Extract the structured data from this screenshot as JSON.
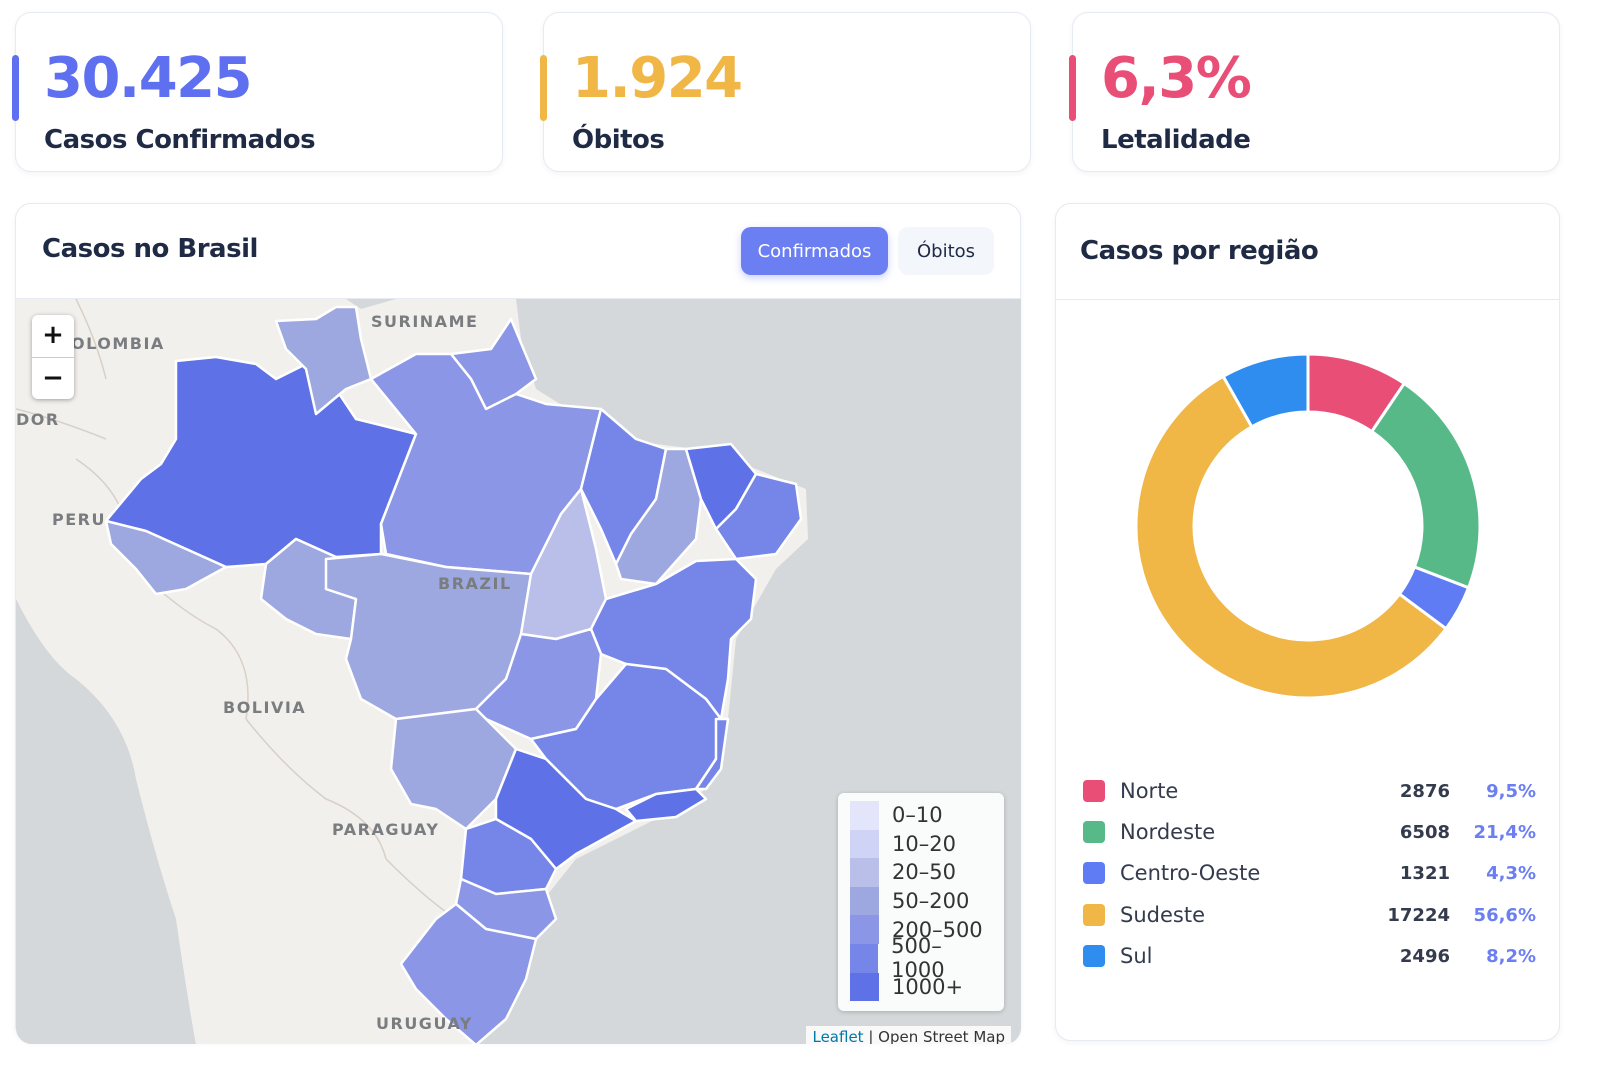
{
  "stats": [
    {
      "value": "30.425",
      "label": "Casos Confirmados",
      "color": "#5e6ff0"
    },
    {
      "value": "1.924",
      "label": "Óbitos",
      "color": "#f0b646"
    },
    {
      "value": "6,3%",
      "label": "Letalidade",
      "color": "#e94e77"
    }
  ],
  "map_card": {
    "title": "Casos no Brasil",
    "toggle": {
      "confirmed_label": "Confirmados",
      "deaths_label": "Óbitos",
      "active": "Confirmados"
    },
    "zoom": {
      "in_label": "+",
      "out_label": "−"
    },
    "country_labels": [
      "SURINAME",
      "OLOMBIA",
      "DOR",
      "PERU",
      "BRAZIL",
      "BOLIVIA",
      "PARAGUAY",
      "URUGUAY"
    ],
    "legend": [
      {
        "label": "0–10",
        "color": "#e3e6fa"
      },
      {
        "label": "10–20",
        "color": "#cfd3f5"
      },
      {
        "label": "20–50",
        "color": "#b9bfe9"
      },
      {
        "label": "50–200",
        "color": "#9ea8e0"
      },
      {
        "label": "200–500",
        "color": "#8b96e6"
      },
      {
        "label": "500–1000",
        "color": "#7585e8"
      },
      {
        "label": "1000+",
        "color": "#5f71e6"
      }
    ],
    "attribution": {
      "link": "Leaflet",
      "rest": " | Open Street Map"
    }
  },
  "region_card": {
    "title": "Casos por região",
    "regions": [
      {
        "name": "Norte",
        "count": "2876",
        "pct": "9,5%",
        "value": 2876,
        "color": "#e94e77"
      },
      {
        "name": "Nordeste",
        "count": "6508",
        "pct": "21,4%",
        "value": 6508,
        "color": "#57b988"
      },
      {
        "name": "Centro-Oeste",
        "count": "1321",
        "pct": "4,3%",
        "value": 1321,
        "color": "#5f7cf5"
      },
      {
        "name": "Sudeste",
        "count": "17224",
        "pct": "56,6%",
        "value": 17224,
        "color": "#f0b646"
      },
      {
        "name": "Sul",
        "count": "2496",
        "pct": "8,2%",
        "value": 2496,
        "color": "#2f8df0"
      }
    ]
  },
  "chart_data": {
    "type": "pie",
    "categories": [
      "Norte",
      "Nordeste",
      "Centro-Oeste",
      "Sudeste",
      "Sul"
    ],
    "values": [
      2876,
      6508,
      1321,
      17224,
      2496
    ],
    "title": "Casos por região"
  }
}
